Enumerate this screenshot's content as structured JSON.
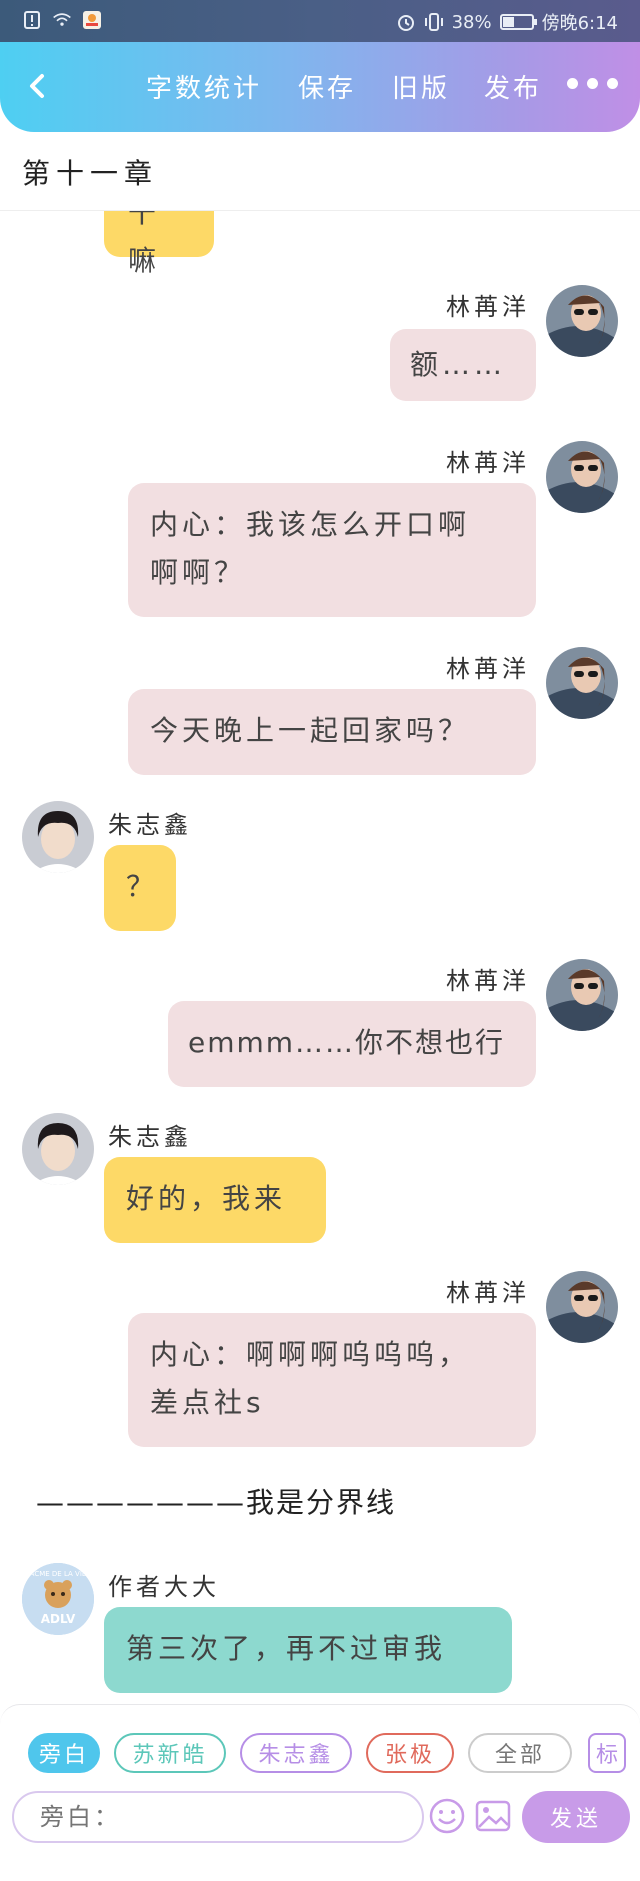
{
  "status_bar": {
    "battery_percent": "38%",
    "battery_level": 0.38,
    "time": "傍晚6:14"
  },
  "header": {
    "word_count_label": "字数统计",
    "save_label": "保存",
    "old_version_label": "旧版",
    "publish_label": "发布"
  },
  "chapter_title": "第十一章",
  "messages": [
    {
      "text": "干嘛"
    },
    {
      "sender": "林苒洋",
      "text": "额……"
    },
    {
      "sender": "林苒洋",
      "text": "内心：我该怎么开口啊",
      "text2": "啊啊？"
    },
    {
      "sender": "林苒洋",
      "text": "今天晚上一起回家吗？"
    },
    {
      "sender": "朱志鑫",
      "text": "？"
    },
    {
      "sender": "林苒洋",
      "text": "emmm……你不想也行"
    },
    {
      "sender": "朱志鑫",
      "text": "好的，我来"
    },
    {
      "sender": "林苒洋",
      "text": "内心：啊啊啊呜呜呜，",
      "text2": "差点社s"
    }
  ],
  "divider": "———————我是分界线",
  "author_message": {
    "sender": "作者大大",
    "text": "第三次了，再不过审我",
    "avatar_text": "ADLV",
    "avatar_ring_text": "ACME DE LA VIE"
  },
  "bottom": {
    "chips": [
      "旁白",
      "苏新皓",
      "朱志鑫",
      "张极",
      "全部"
    ],
    "tag_label": "标",
    "input_placeholder": "旁白：",
    "send_label": "发送"
  },
  "colors": {
    "accent_blue": "#4fc6ec",
    "accent_purple": "#c89be8",
    "bubble_pink": "#f2dfe1",
    "bubble_yellow": "#fdd967",
    "bubble_teal": "#8dd9cf"
  }
}
